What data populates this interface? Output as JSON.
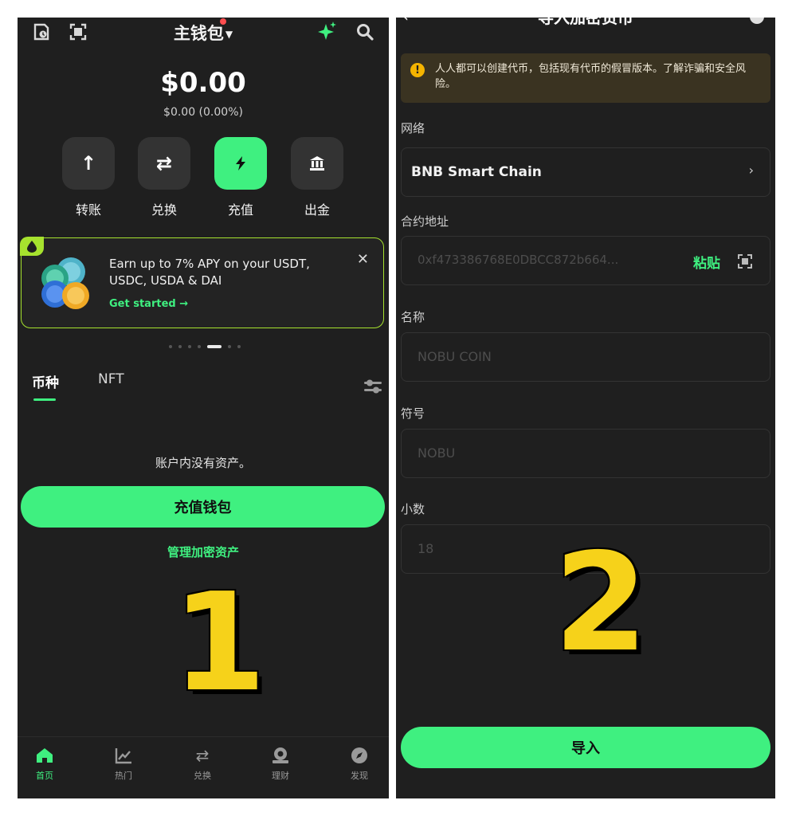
{
  "left": {
    "header": {
      "title": "主钱包"
    },
    "balance": {
      "amount": "$0.00",
      "change": "$0.00 (0.00%)"
    },
    "actions": [
      {
        "label": "转账",
        "icon": "arrow-up-icon"
      },
      {
        "label": "兑换",
        "icon": "swap-icon"
      },
      {
        "label": "充值",
        "icon": "bolt-icon"
      },
      {
        "label": "出金",
        "icon": "bank-icon"
      }
    ],
    "promo": {
      "text": "Earn up to 7% APY on your USDT, USDC, USDA & DAI",
      "cta": "Get started →"
    },
    "tabs": [
      {
        "label": "币种"
      },
      {
        "label": "NFT"
      }
    ],
    "empty_message": "账户内没有资产。",
    "deposit_button": "充值钱包",
    "manage_link": "管理加密资产",
    "overlay_number": "1",
    "nav": [
      {
        "label": "首页",
        "icon": "home-icon"
      },
      {
        "label": "热门",
        "icon": "chart-icon"
      },
      {
        "label": "兑换",
        "icon": "swap-icon"
      },
      {
        "label": "理财",
        "icon": "earn-icon"
      },
      {
        "label": "发现",
        "icon": "compass-icon"
      }
    ],
    "colors": {
      "accent": "#3ff080",
      "promo_border": "#a6e22e",
      "notification": "#ff4d4f"
    }
  },
  "right": {
    "title": "导入加密货币",
    "warning": "人人都可以创建代币，包括现有代币的假冒版本。了解诈骗和安全风险。",
    "network_label": "网络",
    "network_value": "BNB Smart Chain",
    "contract_label": "合约地址",
    "contract_value": "0xf473386768E0DBCC872b664...",
    "paste_label": "粘贴",
    "name_label": "名称",
    "name_placeholder": "NOBU COIN",
    "symbol_label": "符号",
    "symbol_placeholder": "NOBU",
    "decimals_label": "小数",
    "decimals_placeholder": "18",
    "import_button": "导入",
    "overlay_number": "2",
    "colors": {
      "warning_bg": "#3a3321",
      "warning_icon": "#f5b400"
    }
  }
}
